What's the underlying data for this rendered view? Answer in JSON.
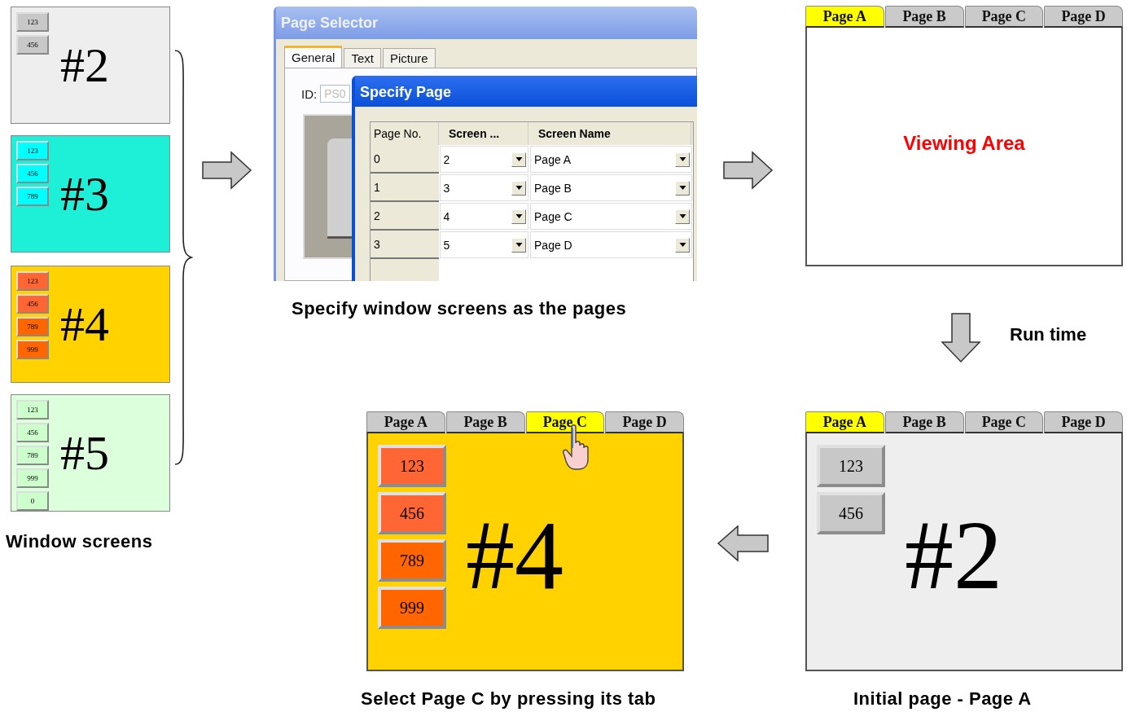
{
  "window_screens": [
    {
      "number": "#2",
      "color": "#eeeeee",
      "buttons": [
        {
          "label": "123",
          "color": "#c8c8c8"
        },
        {
          "label": "456",
          "color": "#c8c8c8"
        }
      ]
    },
    {
      "number": "#3",
      "color": "#1ef0d8",
      "buttons": [
        {
          "label": "123",
          "color": "#00ffff"
        },
        {
          "label": "456",
          "color": "#00ffff"
        },
        {
          "label": "789",
          "color": "#00ffff"
        }
      ]
    },
    {
      "number": "#4",
      "color": "#ffd200",
      "buttons": [
        {
          "label": "123",
          "color": "#ff6633"
        },
        {
          "label": "456",
          "color": "#ff6633"
        },
        {
          "label": "789",
          "color": "#ff6600"
        },
        {
          "label": "999",
          "color": "#ff6600"
        }
      ]
    },
    {
      "number": "#5",
      "color": "#dcffdc",
      "buttons": [
        {
          "label": "123",
          "color": "#ccffcc"
        },
        {
          "label": "456",
          "color": "#ccffcc"
        },
        {
          "label": "789",
          "color": "#ccffcc"
        },
        {
          "label": "999",
          "color": "#ccffcc"
        },
        {
          "label": "0",
          "color": "#ccffcc"
        }
      ]
    }
  ],
  "window_screens_caption": "Window screens",
  "page_selector": {
    "title": "Page Selector",
    "tabs": [
      {
        "label": "General",
        "selected": true
      },
      {
        "label": "Text",
        "selected": false
      },
      {
        "label": "Picture",
        "selected": false
      }
    ],
    "id_label": "ID:",
    "id_value": "PS0",
    "dialog": {
      "title": "Specify Page",
      "columns": [
        "Page No.",
        "Screen ...",
        "Screen Name"
      ],
      "rows": [
        {
          "page_no": "0",
          "screen": "2",
          "name": "Page A"
        },
        {
          "page_no": "1",
          "screen": "3",
          "name": "Page B"
        },
        {
          "page_no": "2",
          "screen": "4",
          "name": "Page C"
        },
        {
          "page_no": "3",
          "screen": "5",
          "name": "Page D"
        }
      ]
    },
    "caption": "Specify window screens as the pages"
  },
  "viewing_area": {
    "tabs": [
      {
        "label": "Page A",
        "selected": true
      },
      {
        "label": "Page B",
        "selected": false
      },
      {
        "label": "Page C",
        "selected": false
      },
      {
        "label": "Page D",
        "selected": false
      }
    ],
    "text": "Viewing Area"
  },
  "run_time_label": "Run time",
  "selected_page": {
    "tabs": [
      {
        "label": "Page A",
        "selected": false
      },
      {
        "label": "Page B",
        "selected": false
      },
      {
        "label": "Page C",
        "selected": true
      },
      {
        "label": "Page D",
        "selected": false
      }
    ],
    "color": "#ffd200",
    "number": "#4",
    "buttons": [
      {
        "label": "123",
        "color": "#ff6633"
      },
      {
        "label": "456",
        "color": "#ff6633"
      },
      {
        "label": "789",
        "color": "#ff6600"
      },
      {
        "label": "999",
        "color": "#ff6600"
      }
    ],
    "caption": "Select Page C by pressing its tab"
  },
  "initial_page": {
    "tabs": [
      {
        "label": "Page A",
        "selected": true
      },
      {
        "label": "Page B",
        "selected": false
      },
      {
        "label": "Page C",
        "selected": false
      },
      {
        "label": "Page D",
        "selected": false
      }
    ],
    "color": "#eeeeee",
    "number": "#2",
    "buttons": [
      {
        "label": "123",
        "color": "#c8c8c8"
      },
      {
        "label": "456",
        "color": "#c8c8c8"
      }
    ],
    "caption": "Initial page - Page A"
  }
}
